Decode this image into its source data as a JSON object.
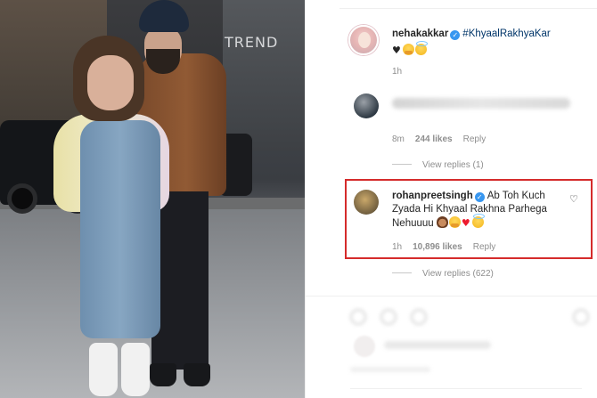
{
  "post_photo": {
    "sign_text": "TREND"
  },
  "comments": [
    {
      "username": "nehakakkar",
      "verified": true,
      "hashtag": "#KhyaalRakhyaKar",
      "emojis": [
        "black-heart",
        "hug-face",
        "halo-face"
      ],
      "time": "1h"
    },
    {
      "username": "",
      "time": "8m",
      "likes": "244 likes",
      "reply_label": "Reply",
      "view_replies": "View replies (1)"
    },
    {
      "username": "rohanpreetsingh",
      "verified": true,
      "text_line1": "Ab Toh Kuch",
      "text_line2": "Zyada Hi Khyaal Rakhna Parhega",
      "text_line3": "Nehuuuu",
      "emojis": [
        "woman-face",
        "hug-face",
        "red-heart",
        "halo-face"
      ],
      "time": "1h",
      "likes": "10,896 likes",
      "reply_label": "Reply",
      "view_replies": "View replies (622)",
      "highlighted": true,
      "highlight_color": "#d52b2b"
    }
  ],
  "colors": {
    "verified_badge": "#3897f0",
    "hashtag": "#003569",
    "meta_text": "#8e8e8e"
  }
}
